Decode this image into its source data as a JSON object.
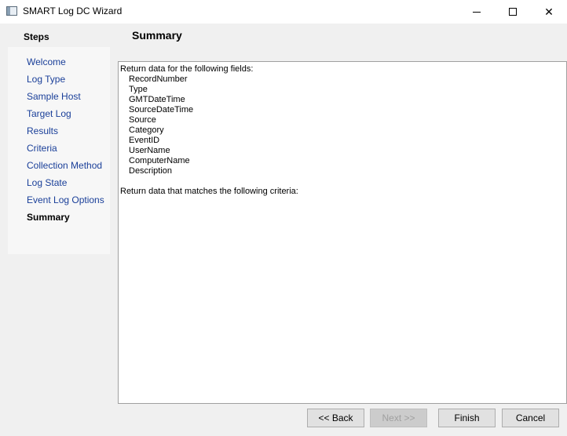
{
  "window": {
    "title": "SMART Log DC Wizard",
    "minimize": "minimize-icon",
    "maximize": "maximize-icon",
    "close": "✕"
  },
  "sidebar": {
    "title": "Steps",
    "items": [
      {
        "label": "Welcome"
      },
      {
        "label": "Log Type"
      },
      {
        "label": "Sample Host"
      },
      {
        "label": "Target Log"
      },
      {
        "label": "Results"
      },
      {
        "label": "Criteria"
      },
      {
        "label": "Collection Method"
      },
      {
        "label": "Log State"
      },
      {
        "label": "Event Log Options"
      },
      {
        "label": "Summary",
        "current": true
      }
    ]
  },
  "header": {
    "title": "Summary"
  },
  "content": {
    "intro": "Return data for the following fields:",
    "fields": [
      "RecordNumber",
      "Type",
      "GMTDateTime",
      "SourceDateTime",
      "Source",
      "Category",
      "EventID",
      "UserName",
      "ComputerName",
      "Description"
    ],
    "criteria_text": "Return data that matches the following criteria:"
  },
  "buttons": {
    "back": "<< Back",
    "next": "Next >>",
    "finish": "Finish",
    "cancel": "Cancel"
  }
}
